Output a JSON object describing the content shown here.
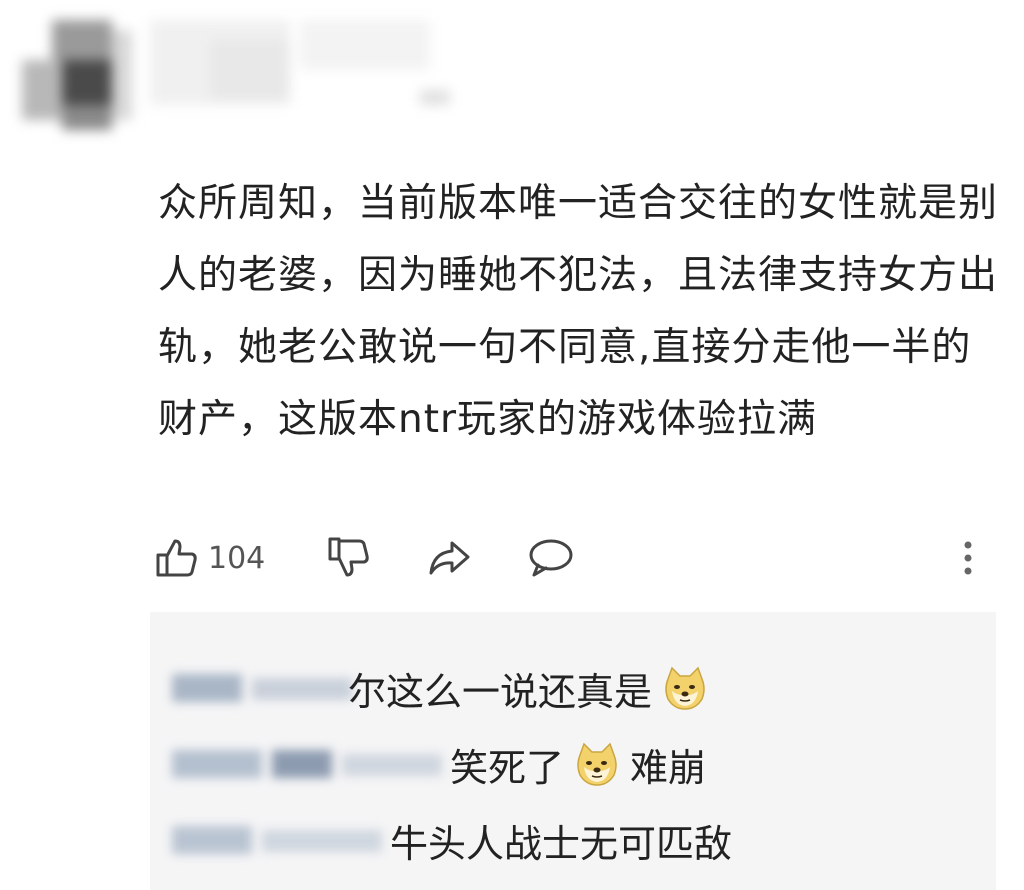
{
  "comment": {
    "text": "众所周知，当前版本唯一适合交往的女性就是别人的老婆，因为睡她不犯法，且法律支持女方出轨，她老公敢说一句不同意,直接分走他一半的财产，这版本ntr玩家的游戏体验拉满"
  },
  "actions": {
    "like_count": "104",
    "icons": [
      "thumbs-up-icon",
      "thumbs-down-icon",
      "share-icon",
      "reply-icon",
      "more-vertical-icon"
    ]
  },
  "replies": [
    {
      "text_before": "尔这么一说还真是",
      "emoji": "doge-emoji",
      "text_after": ""
    },
    {
      "text_before": "笑死了",
      "emoji": "doge-emoji",
      "text_after": "难崩"
    },
    {
      "text_before": "牛头人战士无可匹敌",
      "emoji": "",
      "text_after": ""
    }
  ],
  "colors": {
    "background": "#ffffff",
    "reply_box": "#f5f5f6",
    "text": "#222222",
    "icon": "#444444"
  }
}
